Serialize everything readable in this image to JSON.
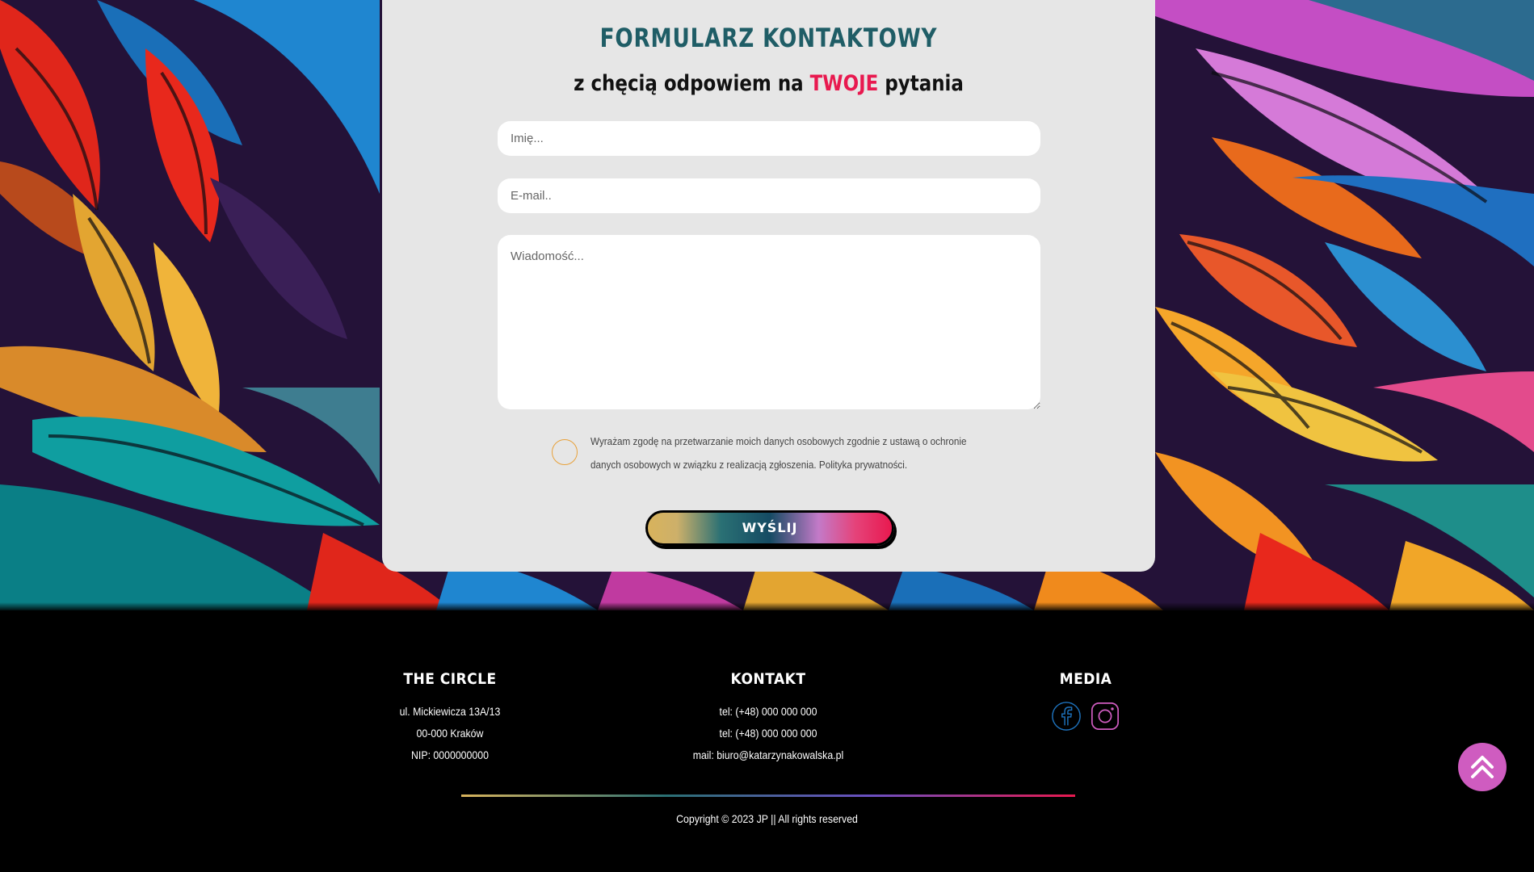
{
  "form": {
    "title": "FORMULARZ KONTAKTOWY",
    "subtitle_before": "z chęcią odpowiem na ",
    "subtitle_accent": "TWOJE",
    "subtitle_after": " pytania",
    "name_placeholder": "Imię...",
    "email_placeholder": "E-mail..",
    "message_placeholder": "Wiadomość...",
    "consent_text": "Wyrażam zgodę na przetwarzanie moich danych osobowych zgodnie z ustawą o ochronie danych osobowych w związku z realizacją zgłoszenia. Polityka prywatności.",
    "submit_label": "WYŚLIJ"
  },
  "footer": {
    "company": {
      "heading": "THE CIRCLE",
      "address_line1": "ul. Mickiewicza 13A/13",
      "address_line2": "00-000 Kraków",
      "nip": "NIP: 0000000000"
    },
    "contact": {
      "heading": "KONTAKT",
      "phone1": "tel: (+48) 000 000 000",
      "phone2": "tel: (+48) 000 000 000",
      "email": "mail: biuro@katarzynakowalska.pl"
    },
    "media": {
      "heading": "MEDIA",
      "icons": [
        "facebook-icon",
        "instagram-icon"
      ]
    },
    "copyright": "Copyright © 2023 JP || All rights reserved"
  },
  "colors": {
    "title": "#1f5d66",
    "accent": "#e8194f",
    "card_bg": "#e6e6e6",
    "scroll_top": "#cf5cc0",
    "facebook": "#1e73be",
    "instagram": "#cf5cc0"
  },
  "icons": {
    "scroll_top": "double-chevron-up-icon"
  }
}
